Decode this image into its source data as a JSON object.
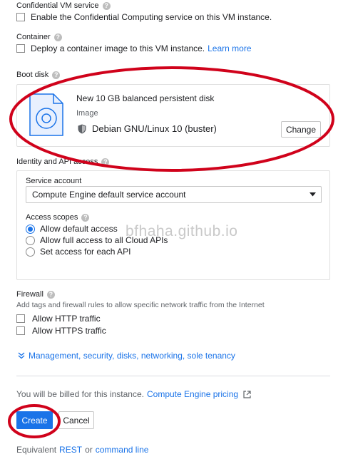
{
  "confidential": {
    "title": "Confidential VM service",
    "checkbox_label": "Enable the Confidential Computing service on this VM instance."
  },
  "container": {
    "title": "Container",
    "checkbox_label": "Deploy a container image to this VM instance.",
    "learn_more": "Learn more"
  },
  "boot_disk": {
    "title": "Boot disk",
    "disk_desc": "New 10 GB balanced persistent disk",
    "image_label": "Image",
    "image_name": "Debian GNU/Linux 10 (buster)",
    "change_button": "Change"
  },
  "identity": {
    "title": "Identity and API access",
    "service_account_label": "Service account",
    "service_account_value": "Compute Engine default service account",
    "access_scopes_label": "Access scopes",
    "scopes": [
      {
        "label": "Allow default access",
        "selected": true
      },
      {
        "label": "Allow full access to all Cloud APIs",
        "selected": false
      },
      {
        "label": "Set access for each API",
        "selected": false
      }
    ]
  },
  "watermark": "bfhaha.github.io",
  "firewall": {
    "title": "Firewall",
    "description": "Add tags and firewall rules to allow specific network traffic from the Internet",
    "http_label": "Allow HTTP traffic",
    "https_label": "Allow HTTPS traffic"
  },
  "management": {
    "link": "Management, security, disks, networking, sole tenancy"
  },
  "billing": {
    "text": "You will be billed for this instance.",
    "pricing_link": "Compute Engine pricing"
  },
  "actions": {
    "create": "Create",
    "cancel": "Cancel"
  },
  "footer": {
    "equivalent": "Equivalent",
    "rest": "REST",
    "or": "or",
    "command_line": "command line"
  },
  "colors": {
    "accent": "#1a73e8",
    "annotation": "#d0021b"
  }
}
